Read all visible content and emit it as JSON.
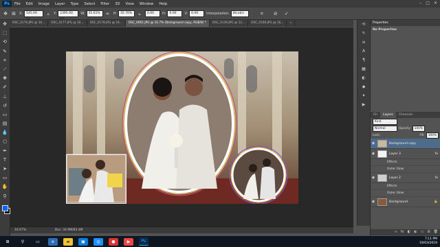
{
  "app": {
    "logo": "Ps"
  },
  "menu": [
    "File",
    "Edit",
    "Image",
    "Layer",
    "Type",
    "Select",
    "Filter",
    "3D",
    "View",
    "Window",
    "Help"
  ],
  "window_controls": {
    "minimize": "–",
    "maximize": "□",
    "close": "✕"
  },
  "options": {
    "x_label": "X:",
    "x_value": "545.00 px",
    "y_label": "Y:",
    "y_value": "2395.00 px",
    "w_label": "W:",
    "w_value": "35.61%",
    "h_label": "H:",
    "h_value": "35.76%",
    "angle_value": "0.00",
    "hskew_label": "H:",
    "hskew_value": "0.00",
    "vskew_label": "V:",
    "vskew_value": "0.00",
    "interp_label": "Interpolation:",
    "interp_value": "Bicubic"
  },
  "tabs": [
    {
      "label": "DSC_0176.JPG @ 16...",
      "active": false
    },
    {
      "label": "DSC_0177.JPG @ 16...",
      "active": false
    },
    {
      "label": "DSC_0178.JPG @ 16...",
      "active": false
    },
    {
      "label": "DSC_0061.JPG @ 16.7% (Background copy, RGB/8) *",
      "active": true
    },
    {
      "label": "DSC_0139.JPG @ 12...",
      "active": false
    },
    {
      "label": "DSC_0168.JPG @ 16...",
      "active": false
    }
  ],
  "tabs_more": "»",
  "status": {
    "zoom": "16.67%",
    "doc": "Doc: 34.9M/83.4M"
  },
  "properties": {
    "tab": "Properties",
    "text": "No Properties"
  },
  "layers_panel": {
    "tabs": [
      "Ch",
      "Layers",
      "Channels"
    ],
    "filter": "Kind",
    "blend": "Normal",
    "opacity_label": "Opacity:",
    "opacity": "100%",
    "lock_label": "Lock:",
    "fill_label": "Fill:",
    "fill": "100%",
    "rows": [
      {
        "name": "Background copy",
        "selected": true,
        "fx": false,
        "color": "#c9b89a"
      },
      {
        "name": "Layer 3",
        "selected": false,
        "fx": true,
        "color": "#f4f4f4"
      },
      {
        "name": "Effects",
        "sub": true
      },
      {
        "name": "Outer Glow",
        "sub": true
      },
      {
        "name": "Layer 2",
        "selected": false,
        "fx": true,
        "color": "#d0d0d0"
      },
      {
        "name": "Effects",
        "sub": true
      },
      {
        "name": "Outer Glow",
        "sub": true
      },
      {
        "name": "Background",
        "selected": false,
        "fx": false,
        "color": "#8a5a3a",
        "italic": true
      }
    ]
  },
  "taskbar": {
    "time": "7:11 PM",
    "date": "19/03/2019"
  },
  "colors": {
    "accent": "#31a8ff",
    "fg_swatch": "#0066ff",
    "bg_swatch": "#111111"
  }
}
